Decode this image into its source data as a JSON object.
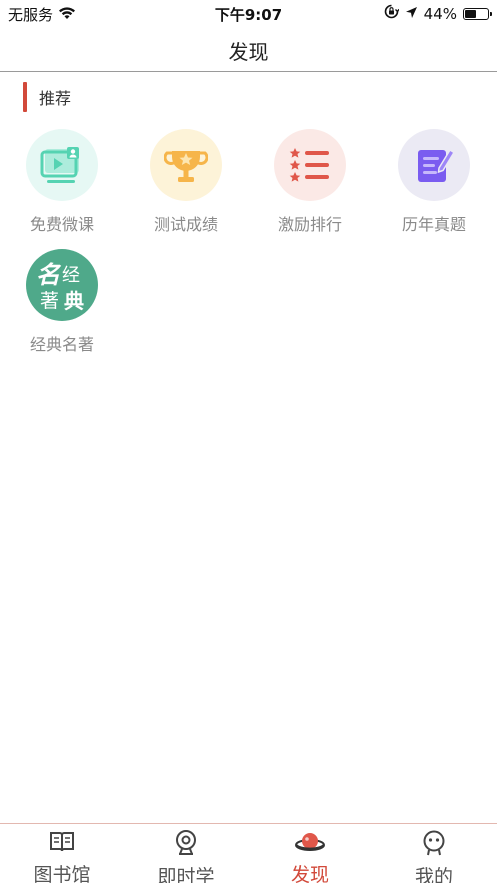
{
  "status": {
    "carrier": "无服务",
    "time": "下午9:07",
    "battery": "44%",
    "battery_level": 0.44,
    "icons": [
      "wifi-icon",
      "orientation-lock-icon",
      "location-arrow-icon",
      "battery-icon"
    ]
  },
  "nav": {
    "title": "发现"
  },
  "section": {
    "title": "推荐",
    "accent": "#d2493a"
  },
  "items": [
    {
      "label": "免费微课",
      "icon": "video-lesson-icon",
      "bg": "#e6f8f4"
    },
    {
      "label": "测试成绩",
      "icon": "trophy-icon",
      "bg": "#fdf3d8"
    },
    {
      "label": "激励排行",
      "icon": "ranking-list-icon",
      "bg": "#fbe9e6"
    },
    {
      "label": "历年真题",
      "icon": "exam-paper-icon",
      "bg": "#ebeaf4"
    },
    {
      "label": "经典名著",
      "icon": "classics-badge-icon",
      "bg": "#4fa98a",
      "badge_text": "名经著典"
    }
  ],
  "tabs": [
    {
      "label": "图书馆",
      "icon": "book-icon"
    },
    {
      "label": "即时学",
      "icon": "webcam-icon"
    },
    {
      "label": "发现",
      "icon": "planet-icon",
      "active": true
    },
    {
      "label": "我的",
      "icon": "profile-face-icon"
    }
  ]
}
